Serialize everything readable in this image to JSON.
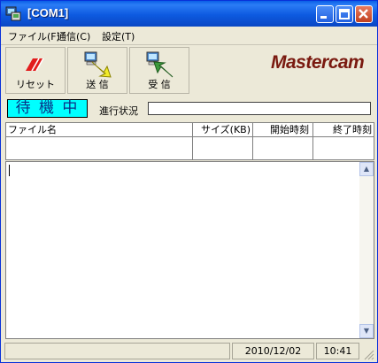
{
  "window": {
    "title": "[COM1]"
  },
  "menu": {
    "items": [
      "ファイル(F)",
      "通信(C)",
      "設定(T)"
    ]
  },
  "toolbar": {
    "reset_label": "リセット",
    "send_label": "送 信",
    "receive_label": "受 信"
  },
  "logo": {
    "text": "Mastercam"
  },
  "status": {
    "badge": "待 機 中",
    "progress_label": "進行状況"
  },
  "table": {
    "headers": [
      "ファイル名",
      "サイズ(KB)",
      "開始時刻",
      "終了時刻"
    ]
  },
  "statusbar": {
    "date": "2010/12/02",
    "time": "10:41"
  },
  "colors": {
    "titlebar": "#0a5fe6",
    "badge_bg": "#00ffff",
    "logo": "#7a1a10"
  }
}
